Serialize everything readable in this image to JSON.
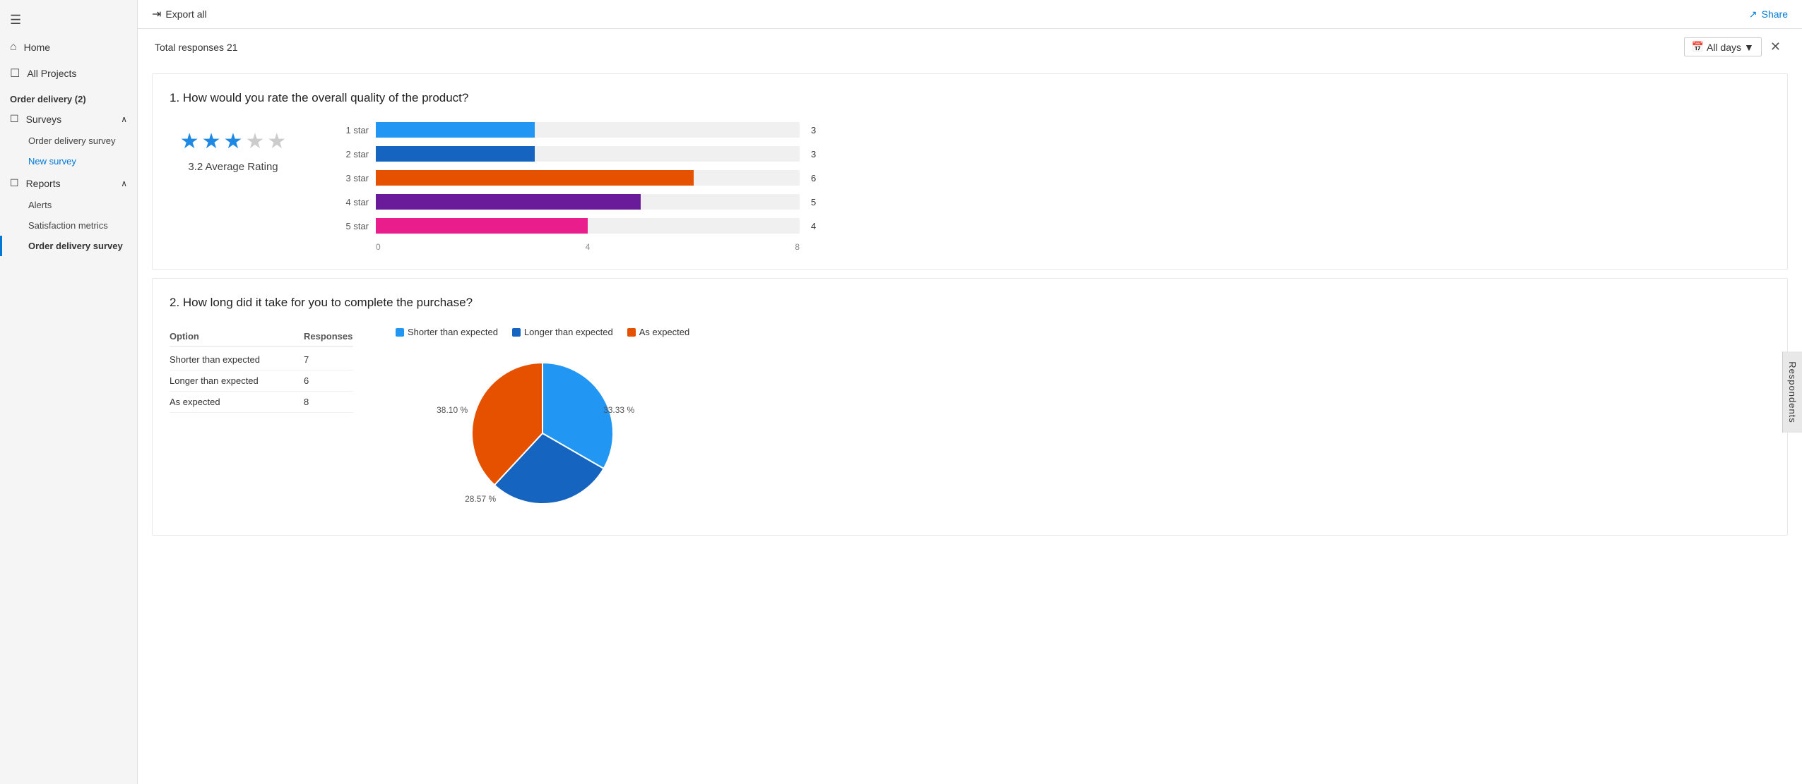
{
  "sidebar": {
    "menu_icon": "☰",
    "nav_items": [
      {
        "id": "home",
        "label": "Home",
        "icon": "⌂"
      },
      {
        "id": "all-projects",
        "label": "All Projects",
        "icon": "☐"
      }
    ],
    "group_title": "Order delivery (2)",
    "surveys_label": "Surveys",
    "surveys_items": [
      {
        "id": "order-delivery-survey-nav",
        "label": "Order delivery survey"
      },
      {
        "id": "new-survey-nav",
        "label": "New survey",
        "active_blue": true
      }
    ],
    "reports_label": "Reports",
    "reports_items": [
      {
        "id": "alerts-nav",
        "label": "Alerts"
      },
      {
        "id": "satisfaction-metrics-nav",
        "label": "Satisfaction metrics"
      },
      {
        "id": "order-delivery-survey-report-nav",
        "label": "Order delivery survey",
        "active_selected": true
      }
    ]
  },
  "topbar": {
    "export_label": "Export all",
    "export_icon": "→",
    "share_label": "Share",
    "share_icon": "↗"
  },
  "filter_bar": {
    "total_responses_label": "Total responses 21",
    "days_filter_label": "All days",
    "days_filter_icon": "▼",
    "calendar_icon": "📅",
    "collapse_icon": "✕"
  },
  "question1": {
    "title": "1. How would you rate the overall quality of the product?",
    "average_rating": 3.2,
    "average_label": "3.2 Average Rating",
    "stars_filled": 3,
    "stars_empty": 2,
    "bars": [
      {
        "label": "1 star",
        "value": 3,
        "max": 8,
        "color": "#2196F3"
      },
      {
        "label": "2 star",
        "value": 3,
        "max": 8,
        "color": "#1565C0"
      },
      {
        "label": "3 star",
        "value": 6,
        "max": 8,
        "color": "#E65100"
      },
      {
        "label": "4 star",
        "value": 5,
        "max": 8,
        "color": "#6A1B9A"
      },
      {
        "label": "5 star",
        "value": 4,
        "max": 8,
        "color": "#E91E8C"
      }
    ],
    "axis_labels": [
      "0",
      "4",
      "8"
    ]
  },
  "question2": {
    "title": "2. How long did it take for you to complete the purchase?",
    "table_headers": {
      "option": "Option",
      "responses": "Responses"
    },
    "table_rows": [
      {
        "option": "Shorter than expected",
        "responses": 7
      },
      {
        "option": "Longer than expected",
        "responses": 6
      },
      {
        "option": "As expected",
        "responses": 8
      }
    ],
    "pie": {
      "segments": [
        {
          "label": "Shorter than expected",
          "value": 7,
          "percent": 33.33,
          "color": "#2196F3",
          "percent_label": "33.33 %"
        },
        {
          "label": "Longer than expected",
          "value": 6,
          "percent": 28.57,
          "color": "#1565C0",
          "percent_label": "28.57 %"
        },
        {
          "label": "As expected",
          "value": 8,
          "percent": 38.1,
          "color": "#E65100",
          "percent_label": "38.10 %"
        }
      ]
    }
  },
  "respondents_tab": "Respondents"
}
